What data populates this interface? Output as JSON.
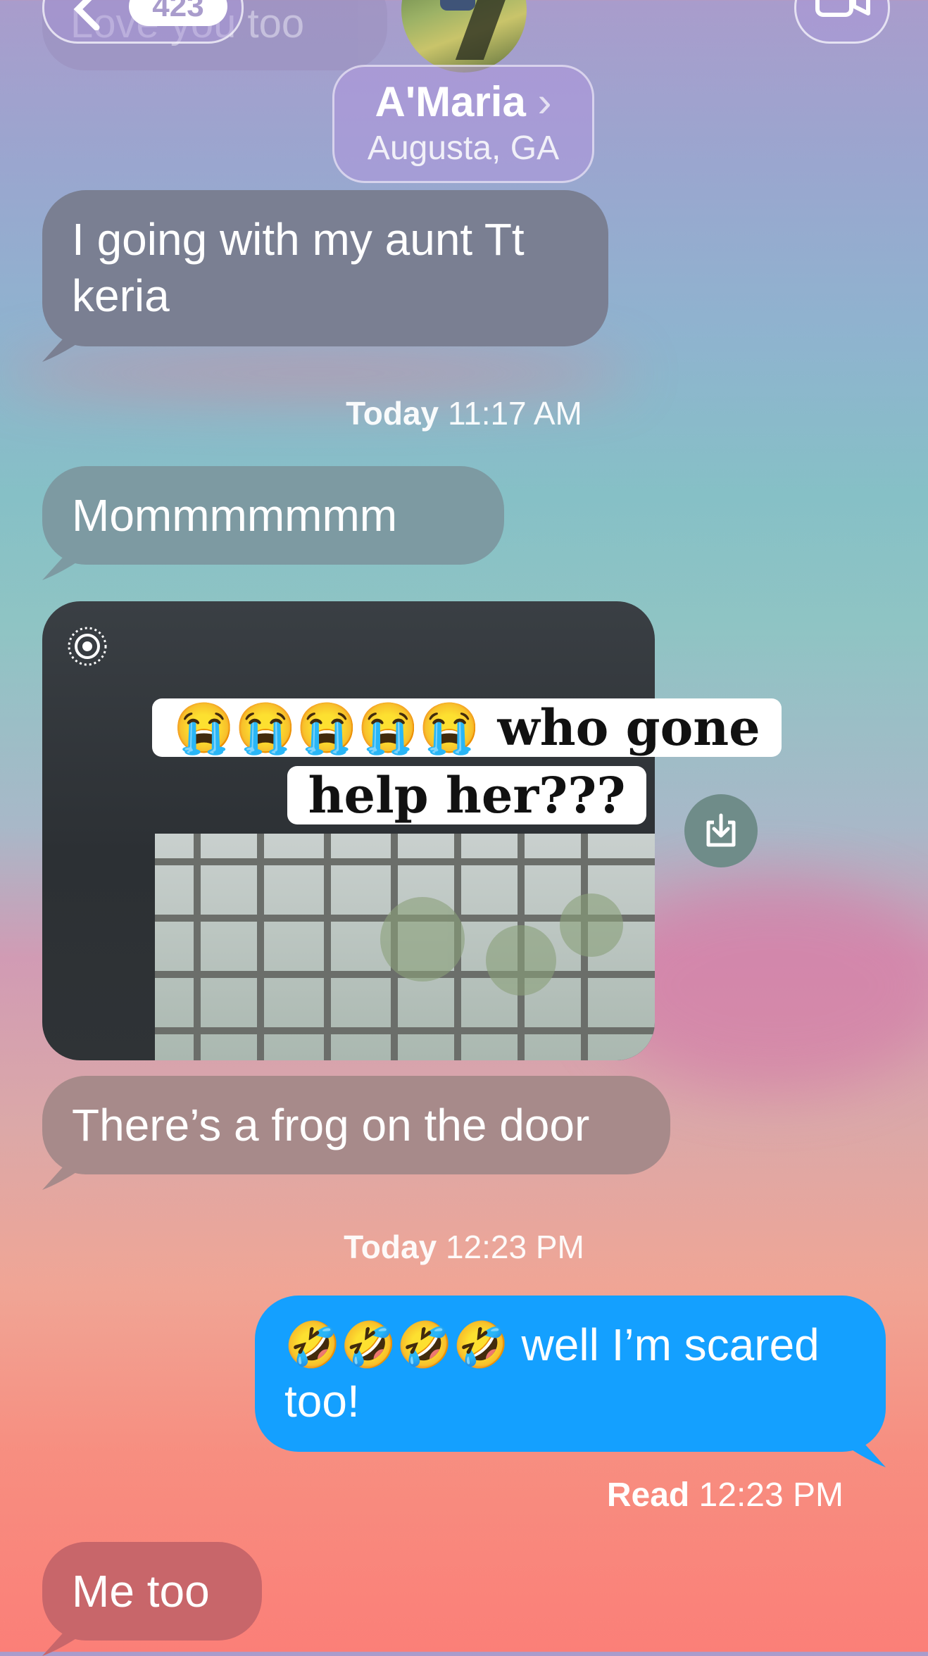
{
  "colors": {
    "incoming_gray": "#7a7f92",
    "outgoing_blue": "#14a0ff",
    "frog_bubble": "#a78a8a",
    "metoo_bubble": "#c8666a"
  },
  "header": {
    "back_icon": "chevron-left-icon",
    "unread_badge": "423",
    "contact_name": "A'Maria",
    "contact_chevron": "›",
    "contact_location": "Augusta, GA",
    "facetime_icon": "video-camera-icon"
  },
  "messages": {
    "prev_partial": "Love you too",
    "m1": "I going with my aunt Tt keria",
    "stamp1_day": "Today",
    "stamp1_time": "11:17 AM",
    "m2": "Mommmmmmm",
    "photo": {
      "caption": "😭😭😭😭😭 who gone help her???",
      "live_icon": "live-photo-icon",
      "save_icon": "download-icon"
    },
    "m3": "There’s a frog on the door",
    "stamp2_day": "Today",
    "stamp2_time": "12:23 PM",
    "sent1": "🤣🤣🤣🤣 well I’m scared too!",
    "read_label": "Read",
    "read_time": "12:23 PM",
    "m4": "Me too"
  }
}
